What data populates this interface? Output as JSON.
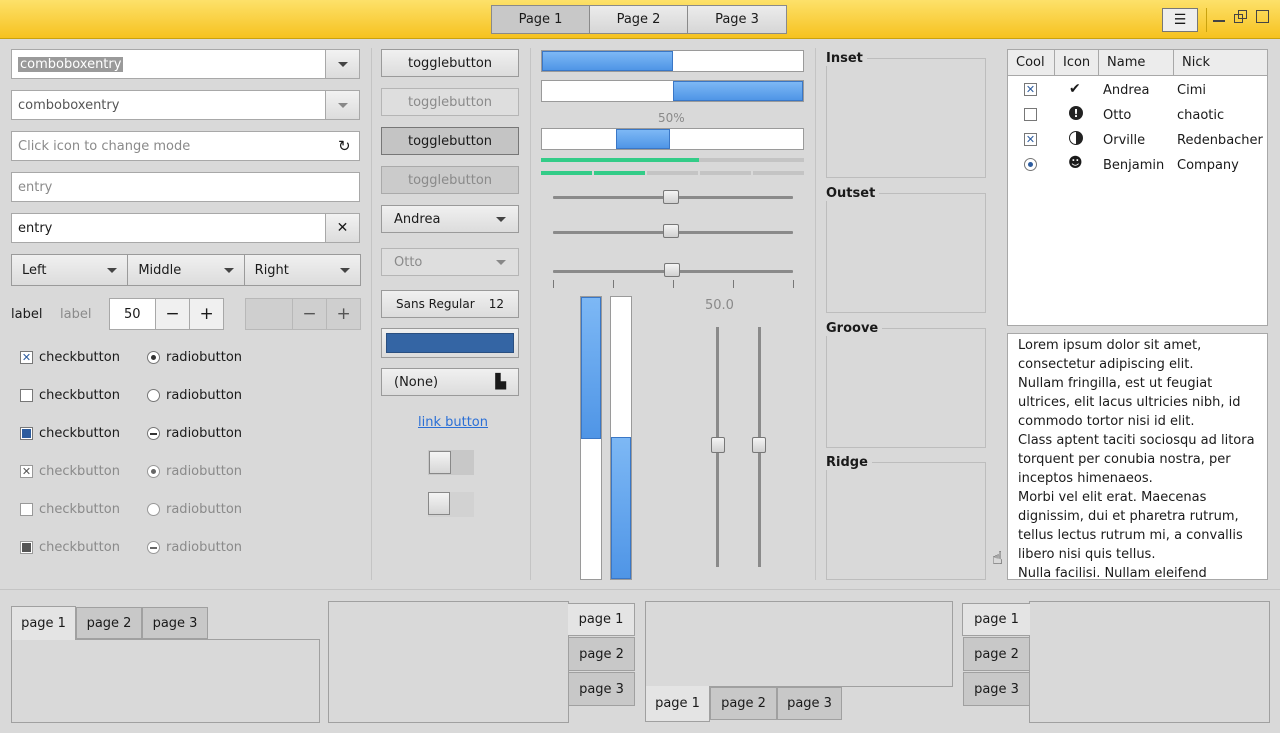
{
  "header": {
    "stack_tabs": [
      "Page 1",
      "Page 2",
      "Page 3"
    ],
    "menu_icon": "hamburger-icon"
  },
  "col1": {
    "combo1": "comboboxentry",
    "combo2": "comboboxentry",
    "mode_entry_placeholder": "Click icon to change mode",
    "entry_placeholder": "entry",
    "entry_value": "entry",
    "segments": [
      "Left",
      "Middle",
      "Right"
    ],
    "label1": "label",
    "label2": "label",
    "spin_value": "50",
    "minus": "−",
    "plus": "+",
    "check_label": "checkbutton",
    "radio_label": "radiobutton"
  },
  "col2": {
    "toggle": "togglebutton",
    "combo_a": "Andrea",
    "combo_b": "Otto",
    "font_name": "Sans Regular",
    "font_size": "12",
    "color_value": "#3465a4",
    "file_none": "(None)",
    "link": "link button"
  },
  "col3": {
    "progress_label": "50%",
    "scale_value": "50.0",
    "progress": [
      0.5,
      0.5,
      0.5
    ]
  },
  "frames": {
    "inset": "Inset",
    "outset": "Outset",
    "groove": "Groove",
    "ridge": "Ridge"
  },
  "tree": {
    "headers": [
      "Cool",
      "Icon",
      "Name",
      "Nick"
    ],
    "rows": [
      {
        "name": "Andrea",
        "nick": "Cimi"
      },
      {
        "name": "Otto",
        "nick": "chaotic"
      },
      {
        "name": "Orville",
        "nick": "Redenbacher"
      },
      {
        "name": "Benjamin",
        "nick": "Company"
      }
    ]
  },
  "textview": {
    "text": "Lorem ipsum dolor sit amet, consectetur adipiscing elit.\nNullam fringilla, est ut feugiat ultrices, elit lacus ultricies nibh, id commodo tortor nisi id elit.\nClass aptent taciti sociosqu ad litora torquent per conubia nostra, per inceptos himenaeos.\nMorbi vel elit erat. Maecenas dignissim, dui et pharetra rutrum, tellus lectus rutrum mi, a convallis libero nisi quis tellus.\nNulla facilisi. Nullam eleifend lobortis"
  },
  "notebooks": {
    "tabs": [
      "page 1",
      "page 2",
      "page 3"
    ]
  }
}
